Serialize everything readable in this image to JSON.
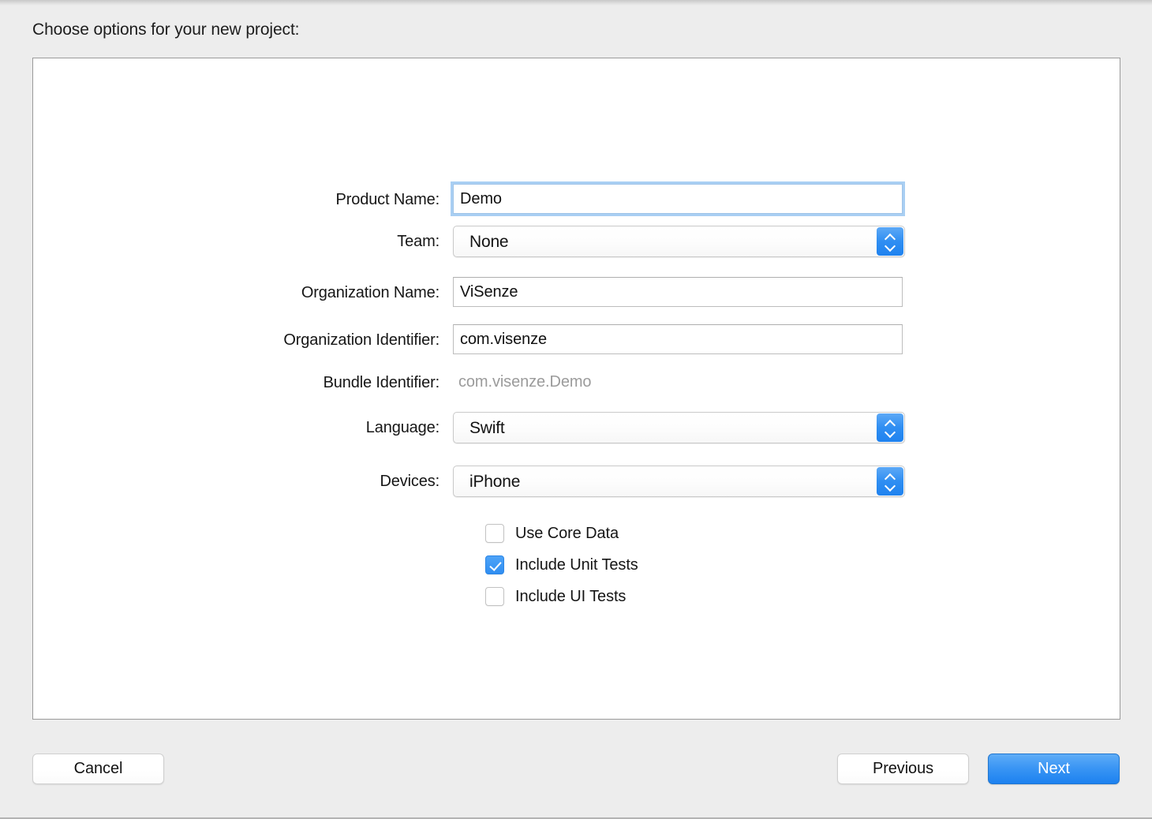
{
  "window": {
    "sheet_title": "Choose options for your new project:"
  },
  "form": {
    "fields": [
      {
        "label": "Product Name:",
        "type": "text",
        "value": "Demo",
        "placeholder": "",
        "focused": true
      },
      {
        "label": "Team:",
        "type": "popup",
        "value": "None"
      },
      {
        "label": "Organization Name:",
        "type": "text",
        "value": "ViSenze",
        "placeholder": "",
        "focused": false
      },
      {
        "label": "Organization Identifier:",
        "type": "text",
        "value": "com.visenze",
        "placeholder": "",
        "focused": false
      },
      {
        "label": "Bundle Identifier:",
        "type": "static",
        "value": "com.visenze.Demo"
      },
      {
        "label": "Language:",
        "type": "popup",
        "value": "Swift"
      },
      {
        "label": "Devices:",
        "type": "popup",
        "value": "iPhone"
      }
    ],
    "checkboxes": [
      {
        "label": "Use Core Data",
        "checked": false
      },
      {
        "label": "Include Unit Tests",
        "checked": true
      },
      {
        "label": "Include UI Tests",
        "checked": false
      }
    ]
  },
  "buttons": {
    "cancel": "Cancel",
    "previous": "Previous",
    "next": "Next"
  },
  "colors": {
    "accent_blue": "#2f8ef2",
    "focus_ring": "#a9cff3",
    "window_background": "#ededed",
    "panel_background": "#ffffff",
    "panel_border": "#9a9a9a",
    "static_text": "#9b9b9b"
  }
}
